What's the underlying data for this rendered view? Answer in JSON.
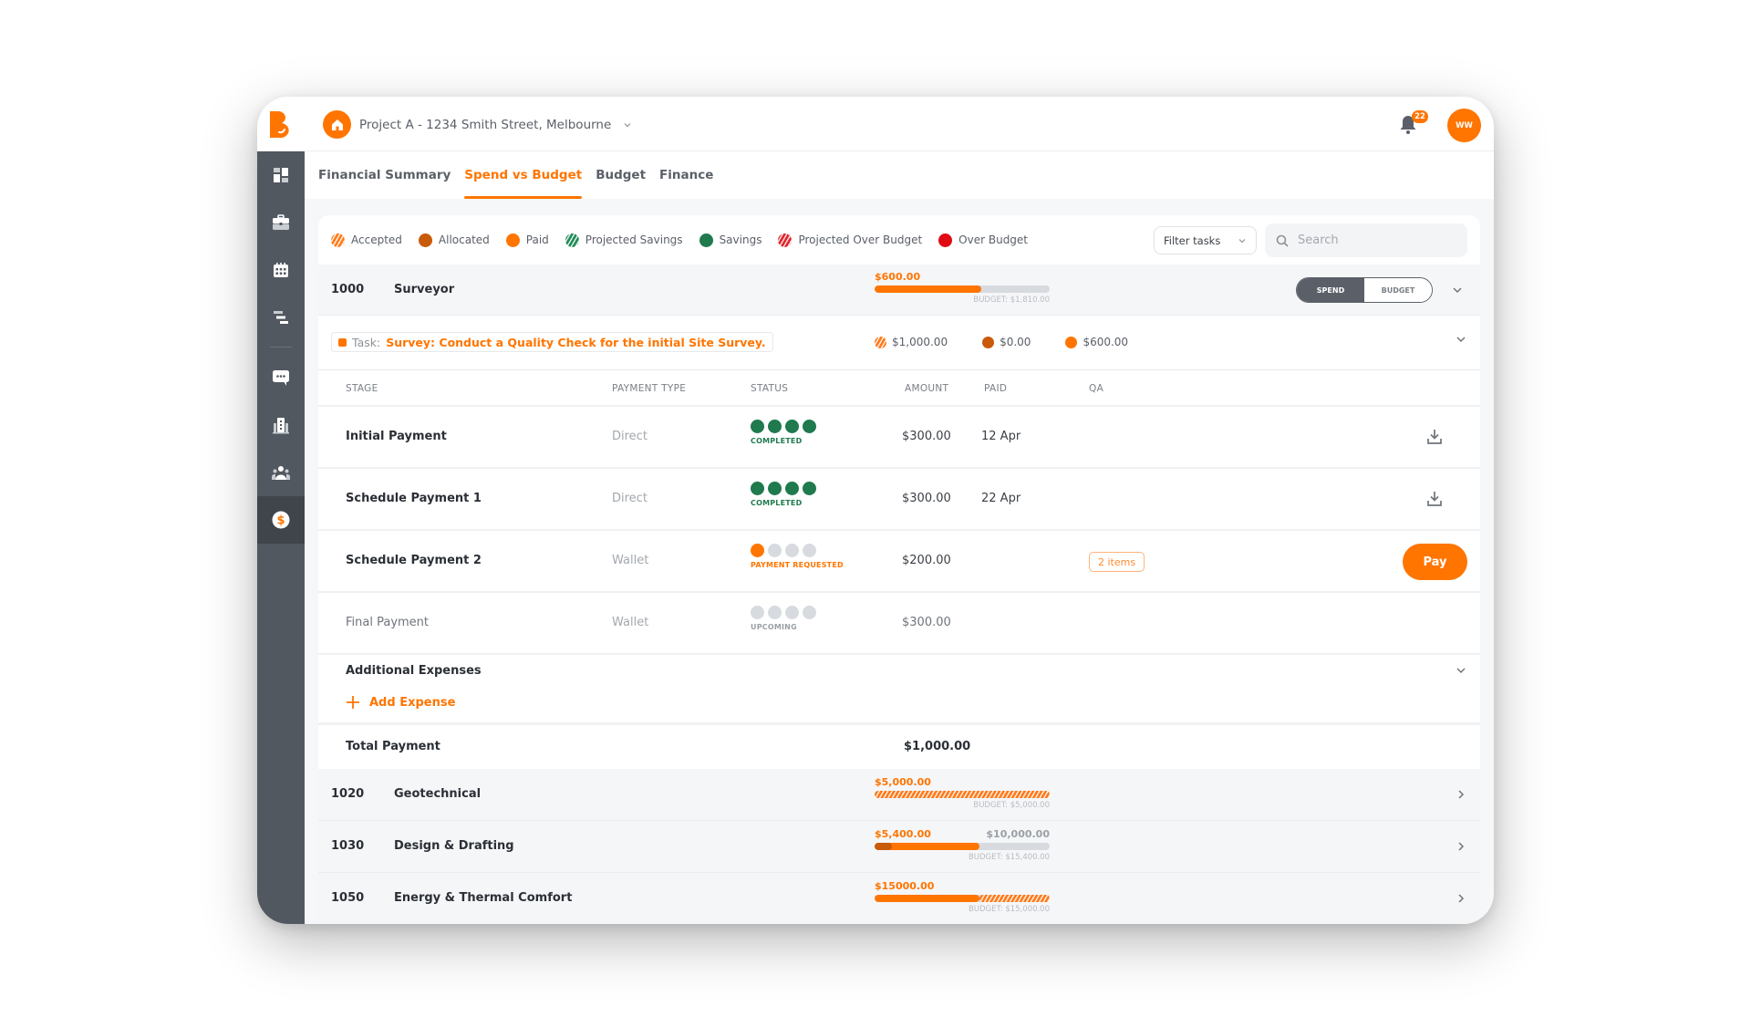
{
  "app": {
    "project_name": "Project A - 1234 Smith Street, Melbourne",
    "notification_count": "22",
    "avatar_initials": "WW",
    "accent_color": "#ff7500"
  },
  "sidebar": {
    "items": [
      {
        "icon": "dashboard-icon",
        "active": false
      },
      {
        "icon": "briefcase-icon",
        "active": false
      },
      {
        "icon": "calendar-icon",
        "active": false
      },
      {
        "icon": "gantt-icon",
        "active": false
      },
      {
        "icon": "chat-icon",
        "active": false
      },
      {
        "icon": "building-icon",
        "active": false
      },
      {
        "icon": "team-icon",
        "active": false
      },
      {
        "icon": "dollar-icon",
        "active": true
      }
    ]
  },
  "tabs": [
    {
      "label": "Financial Summary",
      "active": false
    },
    {
      "label": "Spend vs Budget",
      "active": true
    },
    {
      "label": "Budget",
      "active": false
    },
    {
      "label": "Finance",
      "active": false
    }
  ],
  "legend": [
    {
      "label": "Accepted",
      "color": "#ff7a1a",
      "hatched": true
    },
    {
      "label": "Allocated",
      "color": "#c85a0a",
      "hatched": false
    },
    {
      "label": "Paid",
      "color": "#ff7500",
      "hatched": false
    },
    {
      "label": "Projected Savings",
      "color": "#1f8a56",
      "hatched": true
    },
    {
      "label": "Savings",
      "color": "#1f7a4d",
      "hatched": false
    },
    {
      "label": "Projected Over Budget",
      "color": "#e0242c",
      "hatched": true
    },
    {
      "label": "Over Budget",
      "color": "#e00b14",
      "hatched": false
    }
  ],
  "filter": {
    "label": "Filter tasks"
  },
  "search": {
    "placeholder": "Search",
    "value": ""
  },
  "toggle": {
    "spend_label": "SPEND",
    "budget_label": "BUDGET",
    "selected": "SPEND"
  },
  "groups": [
    {
      "code": "1000",
      "name": "Surveyor",
      "spent": "$600.00",
      "budget_label": "BUDGET: $1,810.00",
      "paid_fraction": 0.61,
      "expanded": true
    },
    {
      "code": "1020",
      "name": "Geotechnical",
      "spent": "$5,000.00",
      "budget_label": "BUDGET: $5,000.00",
      "accepted_fraction": 1.0,
      "expanded": false
    },
    {
      "code": "1030",
      "name": "Design & Drafting",
      "spent": "$5,400.00",
      "secondary_amount": "$10,000.00",
      "budget_label": "BUDGET: $15,400.00",
      "allocated_fraction": 0.1,
      "paid_fraction": 0.6,
      "expanded": false
    },
    {
      "code": "1050",
      "name": "Energy & Thermal Comfort",
      "spent": "$15000.00",
      "budget_label": "BUDGET: $15,000.00",
      "paid_fraction": 0.6,
      "accepted_fraction": 0.4,
      "expanded": false
    }
  ],
  "task": {
    "prefix": "Task:",
    "title": "Survey: Conduct a Quality Check for the initial Site Survey.",
    "accepted": "$1,000.00",
    "allocated": "$0.00",
    "paid": "$600.00"
  },
  "table": {
    "headers": {
      "stage": "STAGE",
      "payment_type": "PAYMENT TYPE",
      "status": "STATUS",
      "amount": "AMOUNT",
      "paid": "PAID",
      "qa": "QA"
    },
    "rows": [
      {
        "stage": "Initial Payment",
        "payment_type": "Direct",
        "status": "COMPLETED",
        "steps_done": 4,
        "amount": "$300.00",
        "paid": "12 Apr",
        "qa": "",
        "action": "download"
      },
      {
        "stage": "Schedule Payment 1",
        "payment_type": "Direct",
        "status": "COMPLETED",
        "steps_done": 4,
        "amount": "$300.00",
        "paid": "22 Apr",
        "qa": "",
        "action": "download"
      },
      {
        "stage": "Schedule Payment 2",
        "payment_type": "Wallet",
        "status": "PAYMENT REQUESTED",
        "steps_done": 1,
        "amount": "$200.00",
        "paid": "",
        "qa": "2 items",
        "action": "Pay"
      },
      {
        "stage": "Final Payment",
        "payment_type": "Wallet",
        "status": "UPCOMING",
        "steps_done": 0,
        "amount": "$300.00",
        "paid": "",
        "qa": "",
        "action": ""
      }
    ]
  },
  "additional_expenses": {
    "title": "Additional Expenses",
    "add_label": "Add Expense"
  },
  "total": {
    "label": "Total Payment",
    "amount": "$1,000.00"
  }
}
